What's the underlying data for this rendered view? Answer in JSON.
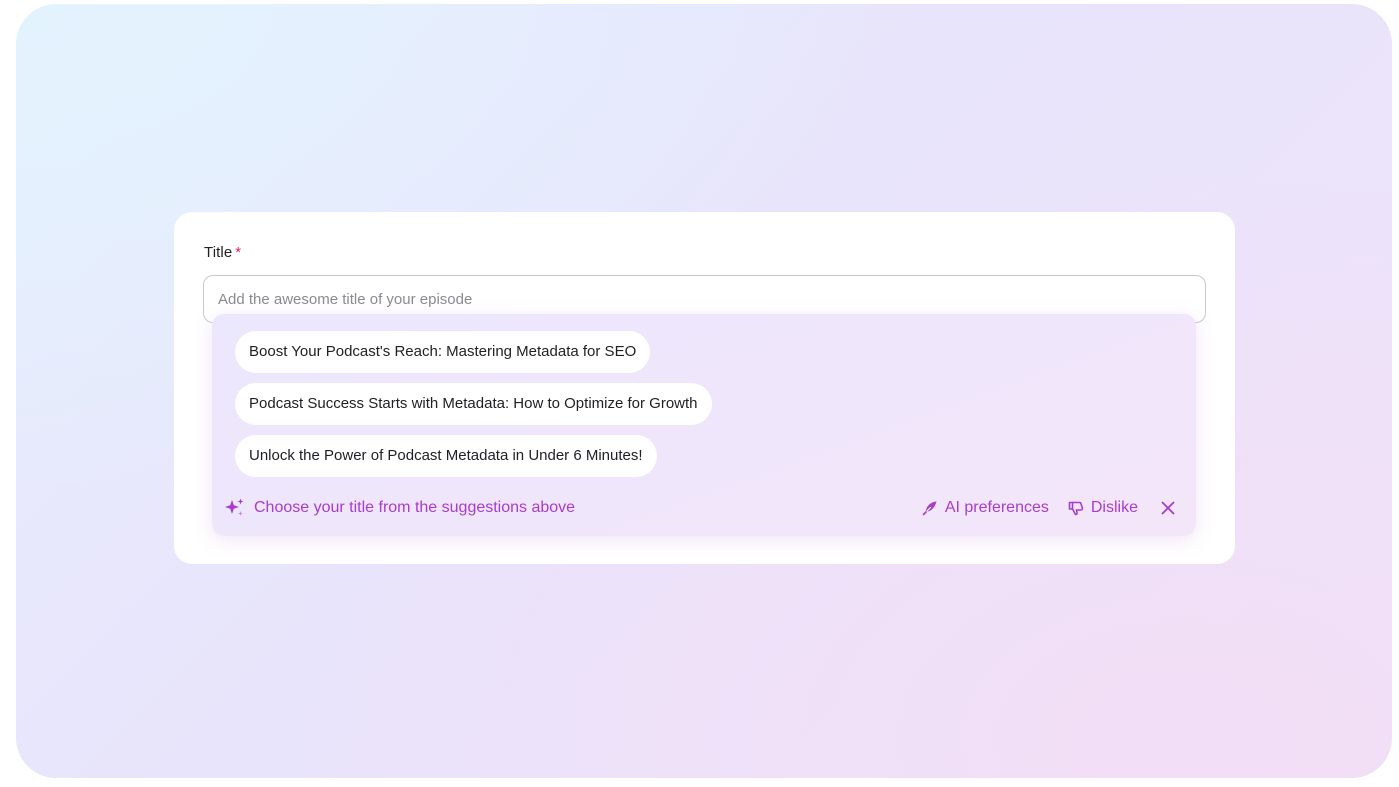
{
  "form": {
    "title_label": "Title",
    "required_marker": "*",
    "title_input": {
      "value": "",
      "placeholder": "Add the awesome title of your episode"
    }
  },
  "suggestions": {
    "items": [
      {
        "label": "Boost Your Podcast's Reach: Mastering Metadata for SEO"
      },
      {
        "label": "Podcast Success Starts with Metadata: How to Optimize for Growth"
      },
      {
        "label": "Unlock the Power of Podcast Metadata in Under 6 Minutes!"
      }
    ],
    "hint": "Choose your title from the suggestions above",
    "hint_icon": "sparkle-icon",
    "ai_preferences_label": "AI preferences",
    "ai_preferences_icon": "feather-icon",
    "dislike_label": "Dislike",
    "dislike_icon": "thumbs-down-icon",
    "close_icon": "close-icon"
  },
  "colors": {
    "accent": "#a83dc9",
    "required": "#e0245e"
  }
}
